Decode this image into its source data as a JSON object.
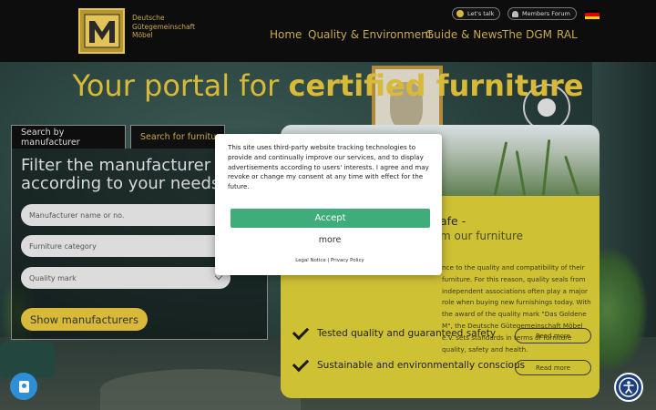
{
  "header": {
    "logo_lines": [
      "Deutsche",
      "Gütegemeinschaft",
      "Möbel"
    ],
    "lets_talk": "Let's talk",
    "members_forum": "Members Forum",
    "nav": [
      "Home",
      "Quality & Environment",
      "Guide & News",
      "The DGM",
      "RAL"
    ]
  },
  "hero": {
    "title_light": "Your portal for ",
    "title_bold": "certified furniture"
  },
  "search": {
    "tab_manufacturer": "Search by manufacturer",
    "tab_furniture": "Search for furniture",
    "heading": "Filter the manufacturer list according to your needs",
    "manufacturer_placeholder": "Manufacturer name or no.",
    "category_placeholder": "Furniture category",
    "quality_placeholder": "Quality mark",
    "show_button": "Show manufacturers"
  },
  "card": {
    "title_fragment": "afe -",
    "subtitle_fragment": "m our furniture",
    "body_fragment": "nce to the quality and compatibility of their furniture. For this reason, quality seals from independent associations often play a major role when buying new furnishings today. With the award of the quality mark \"Das Goldene M\", the Deutsche Gütegemeinschaft Möbel e.V. sets standards in terms of furniture quality, safety and health.",
    "features": [
      {
        "label": "Tested quality and guaranteed safety",
        "button": "Read more"
      },
      {
        "label": "Sustainable and environmentally conscious",
        "button": "Read more"
      }
    ]
  },
  "consent": {
    "text": "This site uses third-party website tracking technologies to provide and continually improve our services, and to display advertisements according to users' interests. I agree and may revoke or change my consent at any time with effect for the future.",
    "accept": "Accept",
    "more": "more",
    "legal_notice": "Legal Notice",
    "separator": " | ",
    "privacy_policy": "Privacy Policy"
  },
  "colors": {
    "brand_gold": "#d9b938",
    "accept_green": "#3ead7a",
    "card_yellow": "#cfc134"
  },
  "icons": {
    "left_fab": "privacy-settings-icon",
    "right_fab": "accessibility-icon"
  }
}
